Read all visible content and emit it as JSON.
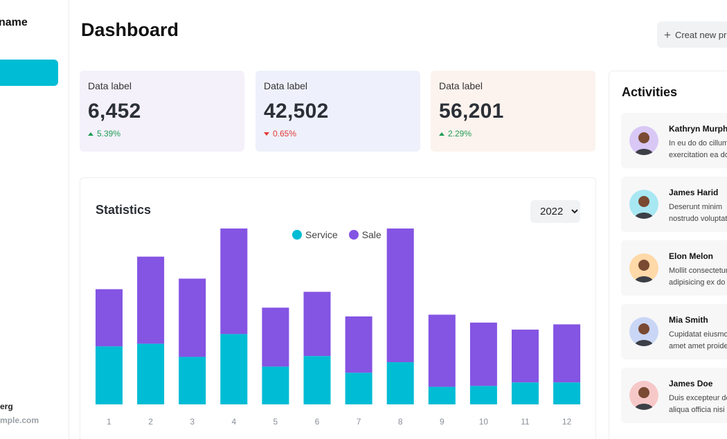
{
  "sidebar": {
    "brand": "name",
    "user_name": "erg",
    "user_email": "mple.com"
  },
  "header": {
    "title": "Dashboard",
    "create_button": "Creat new pr"
  },
  "cards": [
    {
      "label": "Data label",
      "value": "6,452",
      "delta": "5.39%",
      "direction": "up",
      "bg": "#f4f1fb"
    },
    {
      "label": "Data label",
      "value": "42,502",
      "delta": "0.65%",
      "direction": "down",
      "bg": "#eef1fb"
    },
    {
      "label": "Data label",
      "value": "56,201",
      "delta": "2.29%",
      "direction": "up",
      "bg": "#fcf3ee"
    }
  ],
  "statistics": {
    "title": "Statistics",
    "year": "2022",
    "year_options": [
      "2022"
    ]
  },
  "colors": {
    "service": "#00bcd4",
    "sale": "#8454e3",
    "accent": "#00bcd4",
    "up": "#1f9d55",
    "down": "#e53935"
  },
  "chart_data": {
    "type": "bar",
    "stacked": true,
    "categories": [
      "1",
      "2",
      "3",
      "4",
      "5",
      "6",
      "7",
      "8",
      "9",
      "10",
      "11",
      "12"
    ],
    "series": [
      {
        "name": "Service",
        "values": [
          66,
          69,
          54,
          80,
          43,
          55,
          36,
          48,
          20,
          21,
          25,
          25
        ]
      },
      {
        "name": "Sale",
        "values": [
          65,
          99,
          89,
          120,
          67,
          73,
          64,
          152,
          82,
          72,
          60,
          66
        ]
      }
    ],
    "ylim": [
      0,
      200
    ],
    "grid": false,
    "legend": "top-center"
  },
  "activities": {
    "title": "Activities",
    "items": [
      {
        "name": "Kathryn Murphy",
        "text": [
          "In eu do do cillum",
          "exercitation ea do"
        ],
        "avatar_bg": "#d9c8f5",
        "avatar": "avatar-kathryn-icon"
      },
      {
        "name": "James Harid",
        "text": [
          "Deserunt minim",
          "nostrudo voluptate"
        ],
        "avatar_bg": "#a8e8f3",
        "avatar": "avatar-james-harid-icon"
      },
      {
        "name": "Elon Melon",
        "text": [
          "Mollit consectetur",
          "adipisicing ex do"
        ],
        "avatar_bg": "#ffd9a8",
        "avatar": "avatar-elon-icon"
      },
      {
        "name": "Mia Smith",
        "text": [
          "Cupidatat eiusmod",
          "amet amet proident"
        ],
        "avatar_bg": "#c9d6f5",
        "avatar": "avatar-mia-icon"
      },
      {
        "name": "James Doe",
        "text": [
          "Duis excepteur do",
          "aliqua officia nisi"
        ],
        "avatar_bg": "#f7c8c8",
        "avatar": "avatar-james-doe-icon"
      }
    ]
  }
}
